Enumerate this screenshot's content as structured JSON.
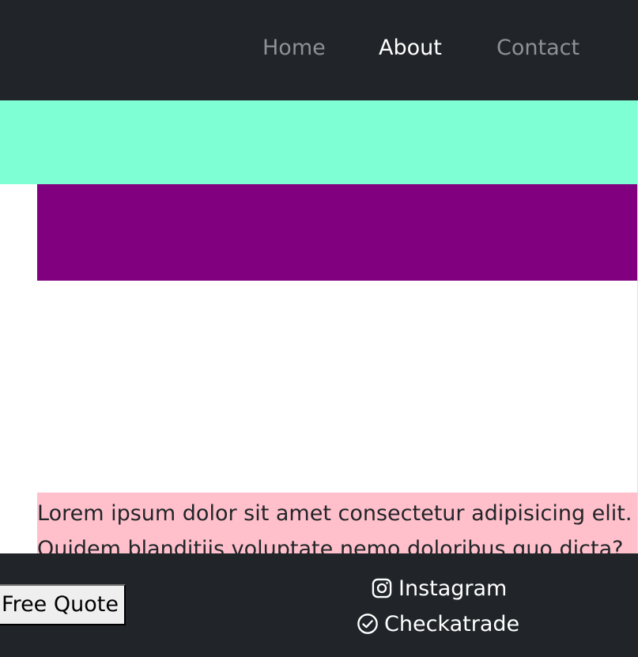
{
  "nav": {
    "links": [
      {
        "label": "Home",
        "active": false
      },
      {
        "label": "About",
        "active": true
      },
      {
        "label": "Contact",
        "active": false
      }
    ]
  },
  "main": {
    "paragraph": "Lorem ipsum dolor sit amet consectetur adipisicing elit. Quidem blanditiis voluptate nemo doloribus quo dicta?"
  },
  "footer": {
    "quote_button": "Free Quote",
    "social": [
      {
        "label": "Instagram",
        "icon": "instagram-icon"
      },
      {
        "label": "Checkatrade",
        "icon": "check-circle-icon"
      }
    ]
  },
  "colors": {
    "navbar_bg": "#212529",
    "nav_active": "#ffffff",
    "nav_inactive": "#8f9194",
    "aqua_band": "#7fffd4",
    "purple_block": "#800080",
    "text_block_bg": "#ffc0cb",
    "footer_bg": "#212529"
  }
}
